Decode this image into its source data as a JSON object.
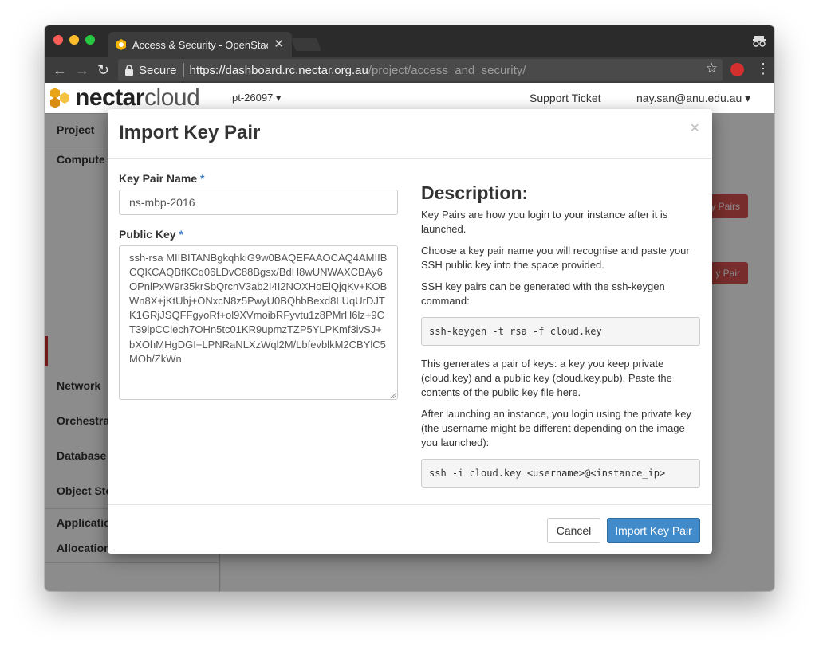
{
  "browser": {
    "tab_title": "Access & Security - OpenStack",
    "tab_close": "✕",
    "secure_label": "Secure",
    "url_host": "https://dashboard.rc.nectar.org.au",
    "url_path": "/project/access_and_security/",
    "back": "←",
    "forward": "→",
    "reload": "↻",
    "star": "☆",
    "menu": "⋮"
  },
  "header": {
    "logo_bold": "nectar",
    "logo_light": "cloud",
    "project": "pt-26097 ▾",
    "support": "Support Ticket",
    "user": "nay.san@anu.edu.au ▾"
  },
  "sidebar": {
    "items": [
      "Project",
      "Compute",
      "Network",
      "Orchestrat",
      "Database",
      "Object Sto",
      "Applicatio",
      "Allocation"
    ]
  },
  "background_buttons": {
    "top": "y Pairs",
    "row": "y Pair"
  },
  "modal": {
    "title": "Import Key Pair",
    "close": "×",
    "name_label": "Key Pair Name",
    "required_mark": "*",
    "name_value": "ns-mbp-2016",
    "key_label": "Public Key",
    "key_value": "ssh-rsa MIIBITANBgkqhkiG9w0BAQEFAAOCAQ4AMIIBCQKCAQBfKCq06LDvC88Bgsx/BdH8wUNWAXCBAy6OPnlPxW9r35krSbQrcnV3ab2I4I2NOXHoElQjqKv+KOBWn8X+jKtUbj+ONxcN8z5PwyU0BQhbBexd8LUqUrDJTK1GRjJSQFFgyoRf+ol9XVmoibRFyvtu1z8PMrH6lz+9CT39lpCClech7OHn5tc01KR9upmzTZP5YLPKmf3ivSJ+bXOhMHgDGI+LPNRaNLXzWql2M/LbfevblkM2CBYlC5MOh/ZkWn",
    "desc_title": "Description:",
    "desc_p1": "Key Pairs are how you login to your instance after it is launched.",
    "desc_p2": "Choose a key pair name you will recognise and paste your SSH public key into the space provided.",
    "desc_p3": "SSH key pairs can be generated with the ssh-keygen command:",
    "code1": "ssh-keygen -t rsa -f cloud.key",
    "desc_p4": "This generates a pair of keys: a key you keep private (cloud.key) and a public key (cloud.key.pub). Paste the contents of the public key file here.",
    "desc_p5": "After launching an instance, you login using the private key (the username might be different depending on the image you launched):",
    "code2": "ssh -i cloud.key <username>@<instance_ip>",
    "cancel": "Cancel",
    "submit": "Import Key Pair"
  },
  "colors": {
    "primary": "#428bca",
    "danger": "#d9534f",
    "required": "#3a7cc1"
  }
}
